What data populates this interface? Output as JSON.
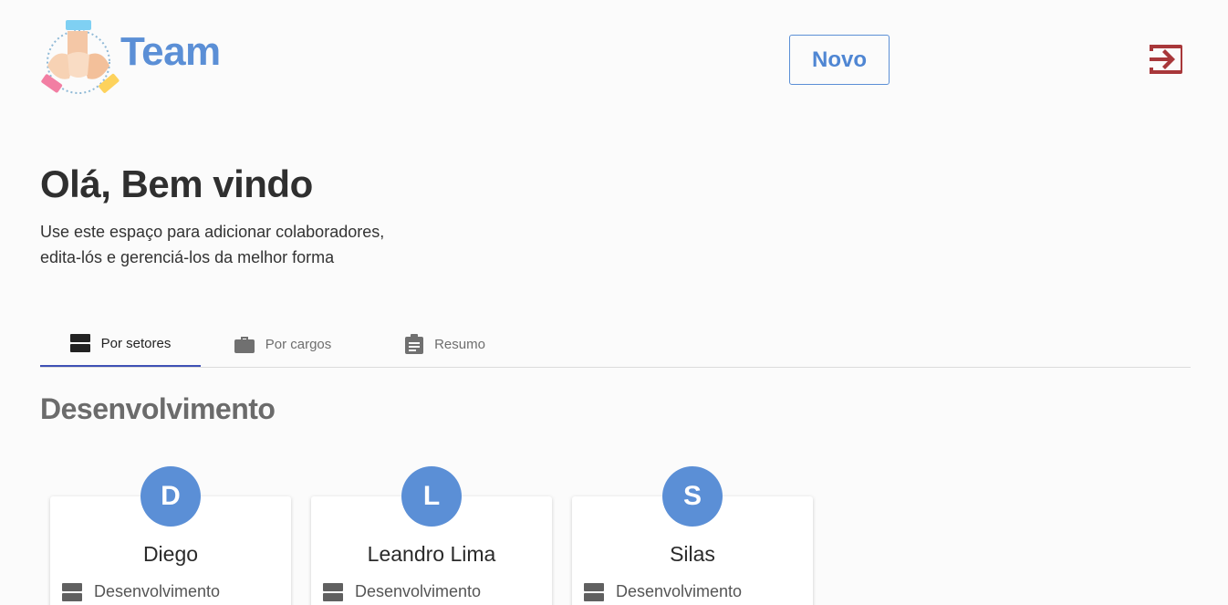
{
  "header": {
    "brand": "Team",
    "new_button": "Novo",
    "logout_icon": "logout-icon"
  },
  "welcome": {
    "title": "Olá, Bem vindo",
    "subtitle_line1": "Use este espaço para adicionar colaboradores,",
    "subtitle_line2": "edita-lós e gerenciá-los da melhor forma"
  },
  "tabs": [
    {
      "label": "Por setores",
      "icon": "sectors-icon",
      "active": true
    },
    {
      "label": "Por cargos",
      "icon": "briefcase-icon",
      "active": false
    },
    {
      "label": "Resumo",
      "icon": "clipboard-icon",
      "active": false
    }
  ],
  "section": {
    "title": "Desenvolvimento"
  },
  "cards": [
    {
      "initial": "D",
      "name": "Diego",
      "sector": "Desenvolvimento"
    },
    {
      "initial": "L",
      "name": "Leandro Lima",
      "sector": "Desenvolvimento"
    },
    {
      "initial": "S",
      "name": "Silas",
      "sector": "Desenvolvimento"
    }
  ],
  "colors": {
    "brand": "#5b8fd6",
    "logout": "#a8373a",
    "tab_indicator": "#3f51b5"
  }
}
